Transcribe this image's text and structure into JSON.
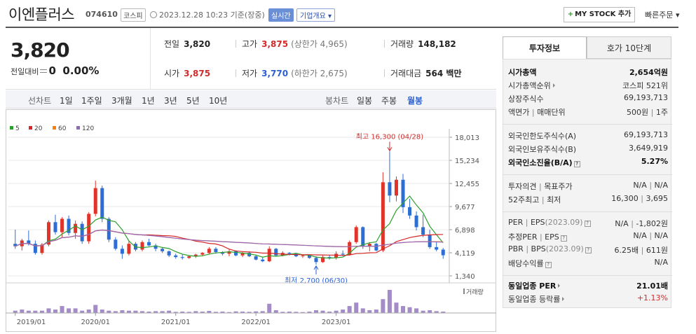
{
  "header": {
    "title": "이엔플러스",
    "code": "074610",
    "market": "코스피",
    "datetime": "2023.12.28 10:23  기준(장중)",
    "realtime_badge": "실시간",
    "company_info_button": "기업개요 ▾",
    "mystock_button": "MY STOCK 추가",
    "quick_order": "빠른주문 ▾"
  },
  "summary": {
    "price": "3,820",
    "change_label": "전일대비",
    "change_value": "0",
    "change_pct": "0.00%",
    "prev_close_label": "전일",
    "prev_close": "3,820",
    "high_label": "고가",
    "high": "3,875",
    "upper_limit": "(상한가 4,965)",
    "volume_label": "거래량",
    "volume": "148,182",
    "open_label": "시가",
    "open": "3,875",
    "low_label": "저가",
    "low": "3,770",
    "lower_limit": "(하한가 2,675)",
    "amount_label": "거래대금",
    "amount": "564 백만"
  },
  "period_tabs": {
    "line_chart": "선차트",
    "periods": [
      "1일",
      "1주일",
      "3개월",
      "1년",
      "3년",
      "5년",
      "10년"
    ],
    "candle_chart": "봉차트",
    "candles": [
      "일봉",
      "주봉",
      "월봉"
    ],
    "active_candle": "월봉"
  },
  "chart_data": {
    "type": "candlestick",
    "legend": [
      {
        "name": "5",
        "color": "#2ca02c"
      },
      {
        "name": "20",
        "color": "#d62728"
      },
      {
        "name": "60",
        "color": "#ff7f0e"
      },
      {
        "name": "120",
        "color": "#9467bd"
      }
    ],
    "y_ticks": [
      "18,013",
      "15,234",
      "12,455",
      "9,677",
      "6,898",
      "4,119",
      "1,340"
    ],
    "ylim": [
      1340,
      18013
    ],
    "x_ticks": [
      "2019/01",
      "2020/01",
      "2021/01",
      "2022/01",
      "2023/01"
    ],
    "volume_label": "거래량",
    "annotation_high": "최고 16,300 (04/28)",
    "annotation_low": "최저 2,700 (06/30)",
    "candles": [
      [
        5200,
        6900,
        4600,
        4900
      ],
      [
        4900,
        5800,
        4400,
        5600
      ],
      [
        5600,
        6800,
        5000,
        5200
      ],
      [
        5200,
        5600,
        3900,
        4100
      ],
      [
        4100,
        5300,
        3900,
        5100
      ],
      [
        5100,
        8000,
        4900,
        7800
      ],
      [
        7800,
        8700,
        6300,
        6600
      ],
      [
        6600,
        8400,
        5900,
        8200
      ],
      [
        8200,
        8600,
        6200,
        6500
      ],
      [
        6500,
        8000,
        5800,
        7600
      ],
      [
        7600,
        7900,
        5200,
        5500
      ],
      [
        5500,
        9000,
        5200,
        8800
      ],
      [
        8800,
        12800,
        8500,
        11900
      ],
      [
        11900,
        12200,
        7800,
        8200
      ],
      [
        8200,
        8400,
        5400,
        5700
      ],
      [
        5700,
        6000,
        4400,
        4600
      ],
      [
        4600,
        5000,
        3400,
        4000
      ],
      [
        4000,
        5600,
        3800,
        5200
      ],
      [
        5200,
        5400,
        4300,
        4500
      ],
      [
        4500,
        5600,
        4300,
        5400
      ],
      [
        5400,
        5800,
        4900,
        5000
      ],
      [
        5000,
        5200,
        4300,
        4600
      ],
      [
        4600,
        4800,
        4100,
        4300
      ],
      [
        4300,
        4400,
        3600,
        3800
      ],
      [
        3800,
        4000,
        3400,
        3600
      ],
      [
        3600,
        3900,
        3300,
        3500
      ],
      [
        3500,
        3800,
        3400,
        3700
      ],
      [
        3700,
        4000,
        3500,
        3900
      ],
      [
        3900,
        4200,
        3700,
        4100
      ],
      [
        4100,
        4800,
        3900,
        4600
      ],
      [
        4600,
        4800,
        4000,
        4200
      ],
      [
        4200,
        4300,
        3800,
        4000
      ],
      [
        4000,
        4500,
        3700,
        4300
      ],
      [
        4300,
        4400,
        3700,
        3800
      ],
      [
        3800,
        4300,
        3600,
        4100
      ],
      [
        4100,
        4300,
        3600,
        3700
      ],
      [
        3700,
        3900,
        3200,
        3300
      ],
      [
        3300,
        3600,
        3000,
        3100
      ],
      [
        3100,
        4900,
        3000,
        4600
      ],
      [
        4600,
        4700,
        3700,
        3800
      ],
      [
        3800,
        4300,
        3700,
        4100
      ],
      [
        4100,
        4200,
        3800,
        4000
      ],
      [
        4000,
        4100,
        3600,
        3700
      ],
      [
        3700,
        3900,
        3500,
        3800
      ],
      [
        3800,
        3900,
        3400,
        3500
      ],
      [
        3500,
        3700,
        2700,
        3000
      ],
      [
        3000,
        3800,
        2900,
        3600
      ],
      [
        3600,
        3900,
        3300,
        3500
      ],
      [
        3500,
        4300,
        3300,
        4000
      ],
      [
        4000,
        4400,
        3700,
        3900
      ],
      [
        3900,
        5600,
        3800,
        5400
      ],
      [
        5400,
        7400,
        5200,
        7200
      ],
      [
        7200,
        7300,
        4600,
        4900
      ],
      [
        4900,
        5400,
        4300,
        5200
      ],
      [
        5200,
        5300,
        4300,
        4400
      ],
      [
        4400,
        13800,
        4200,
        12600
      ],
      [
        12600,
        16300,
        10200,
        11000
      ],
      [
        11000,
        13300,
        10300,
        12900
      ],
      [
        12900,
        13600,
        8900,
        9600
      ],
      [
        9600,
        10600,
        8200,
        8600
      ],
      [
        8600,
        9100,
        6800,
        7200
      ],
      [
        7200,
        8700,
        6000,
        6300
      ],
      [
        6300,
        6900,
        4600,
        4800
      ],
      [
        4800,
        5400,
        4300,
        4500
      ],
      [
        4500,
        4700,
        3400,
        3820
      ]
    ],
    "volumes": [
      1,
      1.5,
      1,
      1,
      1,
      2,
      1.5,
      3,
      2,
      2,
      1,
      1.5,
      3.5,
      1.5,
      1,
      0.8,
      1.2,
      1,
      1,
      0.8,
      0.6,
      0.8,
      0.8,
      1,
      0.5,
      0.6,
      0.5,
      0.8,
      0.6,
      0.9,
      0.5,
      0.6,
      0.4,
      0.7,
      0.6,
      0.5,
      0.7,
      0.8,
      4,
      1.2,
      0.5,
      0.6,
      0.5,
      0.4,
      0.6,
      1.2,
      1,
      0.6,
      1,
      1.5,
      3,
      4.5,
      2,
      1.2,
      1.5,
      6,
      10,
      4.5,
      3,
      2.5,
      2,
      1,
      1.2,
      0.8,
      0.6
    ]
  },
  "right_panel": {
    "tab_invest": "투자정보",
    "tab_quote": "호가 10단계",
    "rows1": {
      "market_cap_label": "시가총액",
      "market_cap": "2,654억원",
      "rank_label": "시가총액순위",
      "rank": "코스피 521위",
      "shares_label": "상장주식수",
      "shares": "69,193,713",
      "par_label": "액면가",
      "trade_unit_label": "매매단위",
      "par": "500원",
      "trade_unit": "1주"
    },
    "rows2": {
      "foreign_limit_label": "외국인한도주식수(A)",
      "foreign_limit": "69,193,713",
      "foreign_hold_label": "외국인보유주식수(B)",
      "foreign_hold": "3,649,919",
      "foreign_ratio_label": "외국인소진율(B/A)",
      "foreign_ratio": "5.27%"
    },
    "rows3": {
      "opinion_label": "투자의견",
      "target_label": "목표주가",
      "opinion": "N/A",
      "target": "N/A",
      "w52_label": "52주최고",
      "w52_low_label": "최저",
      "w52_high": "16,300",
      "w52_low": "3,695"
    },
    "rows4": {
      "per_label": "PER",
      "eps_label": "EPS",
      "period": "(2023.09)",
      "per": "N/A",
      "eps": "-1,802원",
      "est_per_label": "추정PER",
      "est_eps_label": "EPS",
      "est_per": "N/A",
      "est_eps": "N/A",
      "pbr_label": "PBR",
      "bps_label": "BPS",
      "pbr": "6.25배",
      "bps": "611원",
      "div_label": "배당수익률",
      "div": "N/A"
    },
    "rows5": {
      "ind_per_label": "동일업종 PER",
      "ind_per": "21.01배",
      "ind_rate_label": "동일업종 등락률",
      "ind_rate": "+1.13%"
    }
  }
}
